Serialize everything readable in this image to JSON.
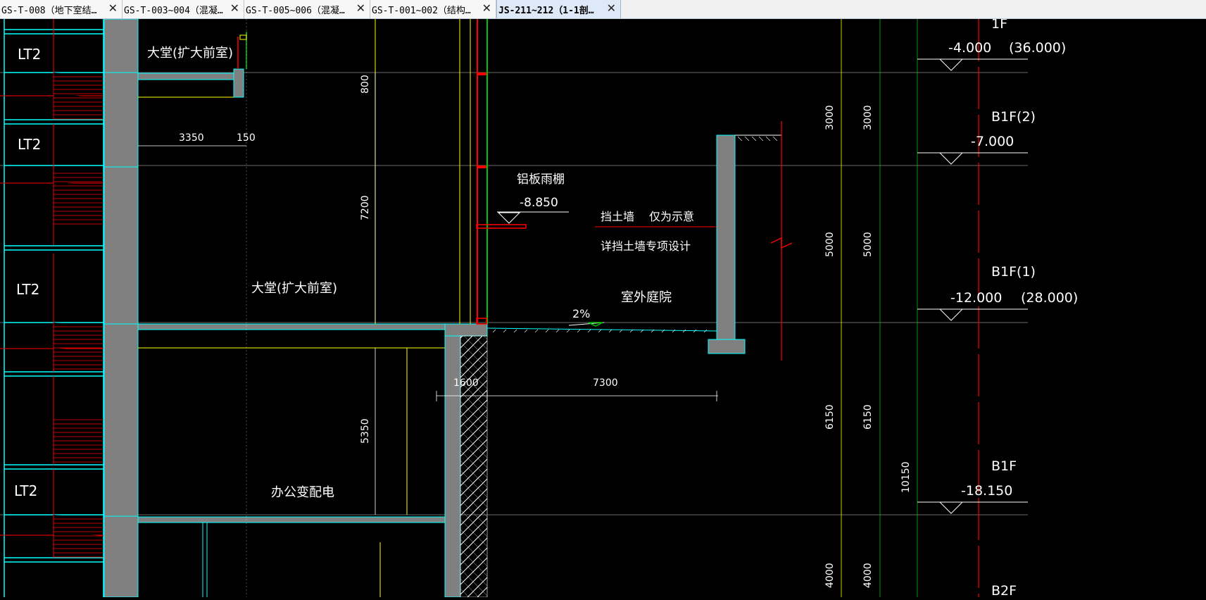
{
  "tabs": [
    {
      "label": "GS-T-008（地下室结…",
      "active": false
    },
    {
      "label": "GS-T-003~004（混凝…",
      "active": false
    },
    {
      "label": "GS-T-005~006（混凝…",
      "active": false
    },
    {
      "label": "GS-T-001~002（结构…",
      "active": false
    },
    {
      "label": "JS-211~212（1-1剖…",
      "active": true
    }
  ],
  "close_glyph": "✕",
  "drawing": {
    "stair_labels": [
      "LT2",
      "LT2",
      "LT2",
      "LT2"
    ],
    "rooms": {
      "lobby_top": "大堂(扩大前室)",
      "lobby_mid": "大堂(扩大前室)",
      "office": "办公变配电",
      "courtyard": "室外庭院"
    },
    "notes": {
      "canopy": "铝板雨棚",
      "canopy_level": "-8.850",
      "retaining_wall": "挡土墙",
      "schematic": "仅为示意",
      "design_note": "详挡土墙专项设计",
      "slope": "2%"
    },
    "dims": {
      "d800": "800",
      "d7200": "7200",
      "d3350": "3350",
      "d150": "150",
      "d5350": "5350",
      "d1600": "1600",
      "d7300": "7300",
      "r3000a": "3000",
      "r3000b": "3000",
      "r5000a": "5000",
      "r5000b": "5000",
      "r6150a": "6150",
      "r6150b": "6150",
      "r10150": "10150",
      "r4000a": "4000",
      "r4000b": "4000"
    },
    "levels": {
      "f1_name": "1F",
      "f1_level": "-4.000",
      "f1_alt": "(36.000)",
      "b1f2_name": "B1F(2)",
      "b1f2_level": "-7.000",
      "b1f1_name": "B1F(1)",
      "b1f1_level": "-12.000",
      "b1f1_alt": "(28.000)",
      "b1f_name": "B1F",
      "b1f_level": "-18.150",
      "b2f_name": "B2F"
    }
  },
  "colors": {
    "background": "#000000",
    "wall": "#808080",
    "cyan": "#00ffff",
    "red": "#ff0000",
    "yellow": "#ffff00",
    "green": "#00c000",
    "white": "#ffffff"
  }
}
